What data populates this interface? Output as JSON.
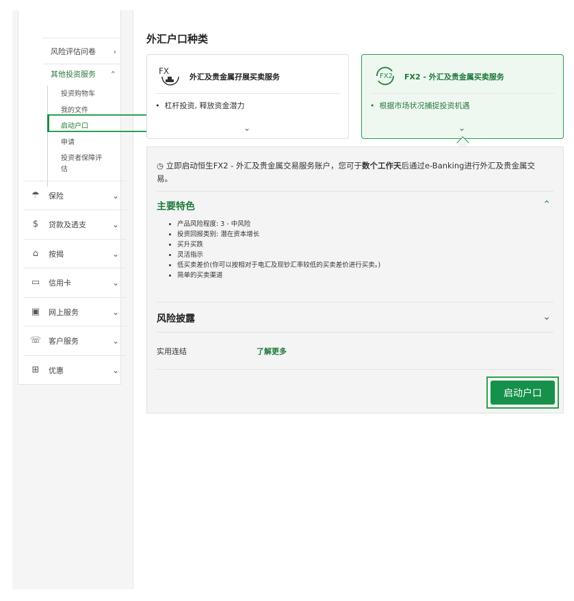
{
  "sidebar": {
    "sub_items": [
      {
        "label": "风险评估问卷",
        "chevron": ">"
      },
      {
        "label": "其他投资服务",
        "chevron": "^"
      }
    ],
    "leaves": [
      "投资购物车",
      "我的文件",
      "启动户口",
      "申请",
      "投资者保障评",
      "估"
    ],
    "categories": [
      {
        "label": "保险",
        "icon": "umbrella-icon",
        "glyph": "☂"
      },
      {
        "label": "贷款及透支",
        "icon": "money-bag-icon",
        "glyph": "$"
      },
      {
        "label": "按揭",
        "icon": "house-icon",
        "glyph": "⌂"
      },
      {
        "label": "信用卡",
        "icon": "credit-card-icon",
        "glyph": "▭"
      },
      {
        "label": "网上服务",
        "icon": "computer-icon",
        "glyph": "▣"
      },
      {
        "label": "客户服务",
        "icon": "phone-icon",
        "glyph": "☏"
      },
      {
        "label": "优惠",
        "icon": "gift-icon",
        "glyph": "⊞"
      }
    ]
  },
  "main": {
    "title": "外汇户口种类",
    "cards": [
      {
        "logo_text": "FX",
        "title": "外汇及贵金属孖展买卖服务",
        "bullet": "杠杆投资, 释放资金潜力"
      },
      {
        "logo_text": "FX2",
        "title": "FX2 - 外汇及贵金属买卖服务",
        "bullet": "根据市场状况捕捉投资机遇"
      }
    ],
    "intro_a": "立即启动恒生FX2 - 外汇及贵金属交易服务账户，您可于",
    "intro_bold": "数个工作天",
    "intro_b": "后通过e-Banking进行外汇及贵金属交易。",
    "features_title": "主要特色",
    "features": [
      "产品风险程度: 3 - 中风险",
      "投资回报类别: 潜在资本增长",
      "买升买跌",
      "灵活指示",
      "低买卖差价(你可以按相对于电汇及现钞汇率较低的买卖差价进行买卖。)",
      "简单的买卖渠道"
    ],
    "risk_title": "风险披露",
    "links_label": "实用连结",
    "links_value": "了解更多",
    "cta_label": "启动户口"
  },
  "colors": {
    "accent": "#15914a",
    "highlight": "#2aa04a",
    "selected_bg": "#eef7f0"
  }
}
